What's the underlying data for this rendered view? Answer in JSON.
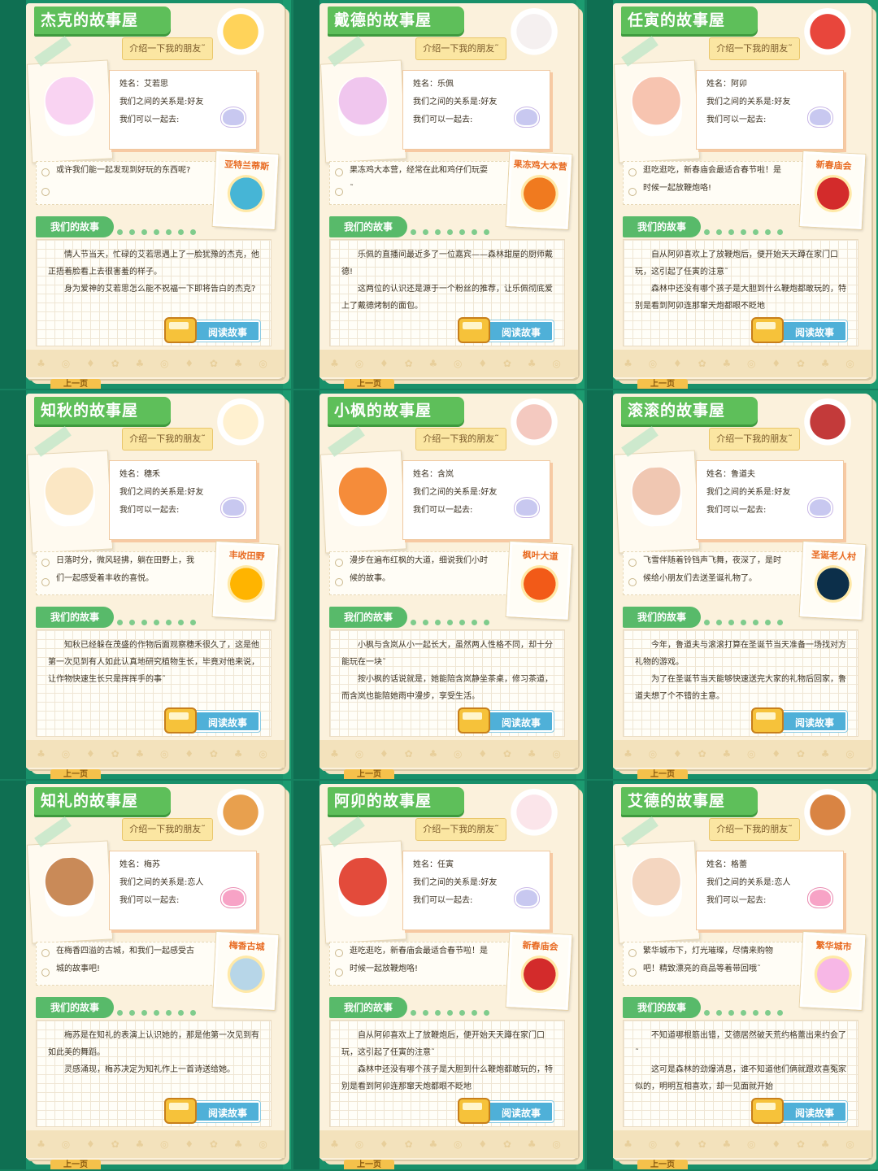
{
  "colors": {
    "background": "#15805f",
    "title_banner": "#5ebf5a",
    "story_tag": "#58ba6a",
    "read_button": "#4fb0d8",
    "place_name": "#e86a21",
    "paper": "#fbf1dc"
  },
  "common": {
    "intro_label": "介绍一下我的朋友˜",
    "story_label": "我们的故事",
    "read_button": "阅读故事",
    "prev_page": "上一页"
  },
  "cards": [
    {
      "title": "杰克的故事屋",
      "name": "姓名：艾若思",
      "relation": "我们之间的关系是:好友",
      "relation_icon": "friend-icon",
      "go_together": "我们可以一起去:",
      "note": "或许我们能一起发现到好玩的东西呢?",
      "place": "亚特兰蒂斯",
      "place_icon": "atlantis-icon",
      "story": [
        "情人节当天，忙碌的艾若思遇上了一脸犹豫的杰克，他正捂着脸看上去很害羞的样子。",
        "身为爱神的艾若思怎么能不祝福一下即将告白的杰克?"
      ],
      "friend_icon": "unicorn-icon",
      "host_icon": "otter-icon"
    },
    {
      "title": "戴德的故事屋",
      "name": "姓名：乐佩",
      "relation": "我们之间的关系是:好友",
      "relation_icon": "friend-icon",
      "go_together": "我们可以一起去:",
      "note": "果冻鸡大本营，经常在此和鸡仔们玩耍˜",
      "place": "果冻鸡大本营",
      "place_icon": "jelly-chicken-icon",
      "story": [
        "乐佩的直播间最近多了一位嘉宾——森林甜屋的厨师戴德!",
        "这两位的认识还是源于一个粉丝的推荐，让乐佩彻底爱上了戴德烤制的面包。"
      ],
      "friend_icon": "pink-cat-icon",
      "host_icon": "chef-icon"
    },
    {
      "title": "任寅的故事屋",
      "name": "姓名：阿卯",
      "relation": "我们之间的关系是:好友",
      "relation_icon": "friend-icon",
      "go_together": "我们可以一起去:",
      "note": "逛吃逛吃，新春庙会最适合春节啦！是时候一起放鞭炮咯!",
      "place": "新春庙会",
      "place_icon": "tiger-mask-icon",
      "story": [
        "自从阿卯喜欢上了放鞭炮后，便开始天天蹲在家门口玩，这引起了任寅的注意˜",
        "森林中还没有哪个孩子是大胆到什么鞭炮都敢玩的，特别是看到阿卯连那窜天炮都眼不眨地"
      ],
      "friend_icon": "rabbit-icon",
      "host_icon": "tiger-icon"
    },
    {
      "title": "知秋的故事屋",
      "name": "姓名：穗禾",
      "relation": "我们之间的关系是:好友",
      "relation_icon": "friend-icon",
      "go_together": "我们可以一起去:",
      "note": "日落时分，微风轻拂，躺在田野上，我们一起感受着丰收的喜悦。",
      "place": "丰收田野",
      "place_icon": "harvest-icon",
      "story": [
        "知秋已经躲在茂盛的作物后面观察穗禾很久了，这是他第一次见到有人如此认真地研究植物生长，毕竟对他来说，让作物快速生长只是挥挥手的事˜"
      ],
      "friend_icon": "deer-icon",
      "host_icon": "sheep-icon"
    },
    {
      "title": "小枫的故事屋",
      "name": "姓名：含岚",
      "relation": "我们之间的关系是:好友",
      "relation_icon": "friend-icon",
      "go_together": "我们可以一起去:",
      "note": "漫步在遍布红枫的大道，细说我们小时候的故事。",
      "place": "枫叶大道",
      "place_icon": "maple-leaf-icon",
      "story": [
        "小枫与含岚从小一起长大，虽然两人性格不同，却十分能玩在一块˜",
        "按小枫的话说就是，她能陪含岚静坐茶桌，修习茶道，而含岚也能陪她雨中漫步，享受生活。"
      ],
      "friend_icon": "squirrel-icon",
      "host_icon": "fox-girl-icon"
    },
    {
      "title": "滚滚的故事屋",
      "name": "姓名：鲁道夫",
      "relation": "我们之间的关系是:好友",
      "relation_icon": "friend-icon",
      "go_together": "我们可以一起去:",
      "note": "飞雪伴随着铃铛声飞舞，夜深了，是时候给小朋友们去送圣诞礼物了。",
      "place": "圣诞老人村",
      "place_icon": "christmas-tree-icon",
      "story": [
        "今年，鲁道夫与滚滚打算在圣诞节当天准备一场找对方礼物的游戏。",
        "为了在圣诞节当天能够快速送完大家的礼物后回家，鲁道夫想了个不错的主意。"
      ],
      "friend_icon": "reindeer-icon",
      "host_icon": "husky-icon"
    },
    {
      "title": "知礼的故事屋",
      "name": "姓名：梅苏",
      "relation": "我们之间的关系是:恋人",
      "relation_icon": "love-icon",
      "go_together": "我们可以一起去:",
      "note": "在梅香四溢的古城，和我们一起感受古城的故事吧!",
      "place": "梅香古城",
      "place_icon": "plum-blossom-icon",
      "story": [
        "梅苏是在知礼的表演上认识她的，那是他第一次见到有如此美的舞蹈。",
        "灵感涌现，梅苏决定为知礼作上一首诗送给她。"
      ],
      "friend_icon": "fawn-icon",
      "host_icon": "opera-icon"
    },
    {
      "title": "阿卯的故事屋",
      "name": "姓名：任寅",
      "relation": "我们之间的关系是:好友",
      "relation_icon": "friend-icon",
      "go_together": "我们可以一起去:",
      "note": "逛吃逛吃，新春庙会最适合春节啦！是时候一起放鞭炮咯!",
      "place": "新春庙会",
      "place_icon": "tiger-mask-icon",
      "story": [
        "自从阿卯喜欢上了放鞭炮后，便开始天天蹲在家门口玩，这引起了任寅的注意˜",
        "森林中还没有哪个孩子是大胆到什么鞭炮都敢玩的，特别是看到阿卯连那窜天炮都眼不眨地"
      ],
      "friend_icon": "tiger-icon",
      "host_icon": "rabbit-icon"
    },
    {
      "title": "艾德的故事屋",
      "name": "姓名：格蕾",
      "relation": "我们之间的关系是:恋人",
      "relation_icon": "love-icon",
      "go_together": "我们可以一起去:",
      "note": "繁华城市下，灯光璀璨，尽情来购物吧！精致漂亮的商品等着带回哦˜",
      "place": "繁华城市",
      "place_icon": "dress-icon",
      "story": [
        "不知道哪根筋出错，艾德居然破天荒约格蕾出来约会了˜",
        "这可是森林的劲爆消息，谁不知道他们俩就跟欢喜冤家似的，明明互相喜欢，却一见面就开始"
      ],
      "friend_icon": "girl-icon",
      "host_icon": "lion-icon"
    }
  ]
}
